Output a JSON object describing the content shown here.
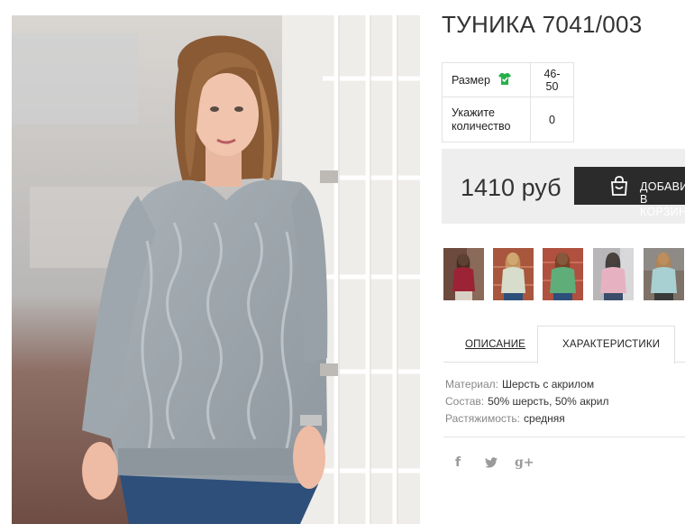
{
  "product": {
    "title": "ТУНИКА 7041/003",
    "main_photo_alt": "main-product-photo"
  },
  "options": {
    "size_label": "Размер",
    "size_value": "46-50",
    "qty_label": "Укажите количество",
    "qty_value": "0"
  },
  "purchase": {
    "price": "1410 руб",
    "add_button": "ДОБАВИТЬ В КОРЗИНУ"
  },
  "thumbnails": [
    {
      "color": "#9b2335",
      "bg": "#6d4a3e"
    },
    {
      "color": "#d7dccb",
      "bg": "#a8563e"
    },
    {
      "color": "#5fae7a",
      "bg": "#b0503e"
    },
    {
      "color": "#e6b2c2",
      "bg": "#b8b6b8"
    },
    {
      "color": "#a8cfd1",
      "bg": "#7e7168"
    }
  ],
  "tabs": {
    "description": "ОПИСАНИЕ",
    "characteristics": "ХАРАКТЕРИСТИКИ"
  },
  "characteristics": [
    {
      "key": "Материал:",
      "value": "Шерсть с акрилом"
    },
    {
      "key": "Состав:",
      "value": "50% шерсть, 50% акрил"
    },
    {
      "key": "Растяжимость:",
      "value": "средняя"
    }
  ],
  "social": {
    "facebook": "f",
    "twitter": "twitter-bird",
    "googleplus": "g+"
  },
  "icons": {
    "size_icon": "tshirt-check-icon",
    "bag_icon": "shopping-bag-icon"
  },
  "colors": {
    "accent_green": "#25b14a",
    "button_dark": "#2b2b2b",
    "price_bg": "#eeeeee",
    "sweater_grey": "#9aa3aa"
  }
}
